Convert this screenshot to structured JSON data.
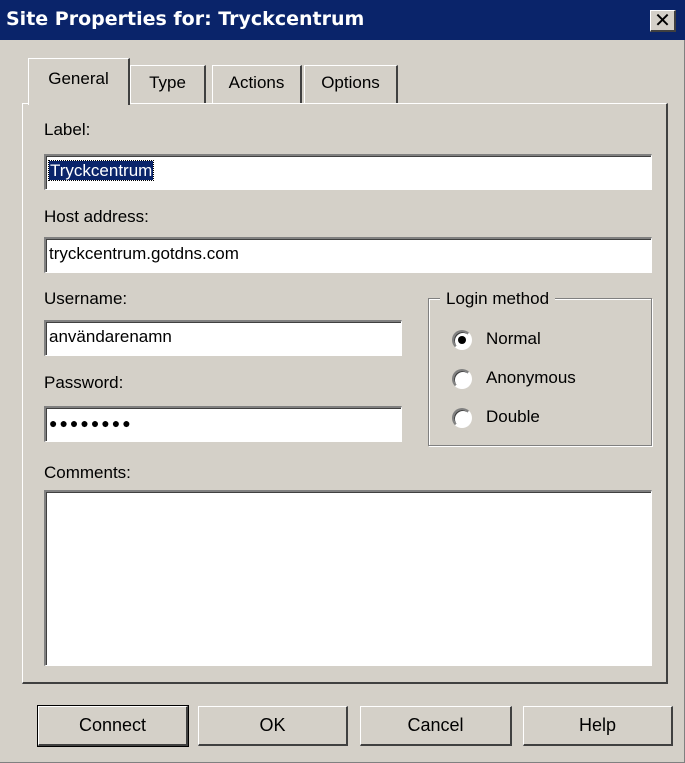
{
  "window": {
    "title": "Site Properties for: Tryckcentrum",
    "close_glyph": "✕"
  },
  "tabs": [
    {
      "label": "General",
      "active": true
    },
    {
      "label": "Type",
      "active": false
    },
    {
      "label": "Actions",
      "active": false
    },
    {
      "label": "Options",
      "active": false
    }
  ],
  "form": {
    "label_caption": "Label:",
    "label_value": "Tryckcentrum",
    "host_caption": "Host address:",
    "host_value": "tryckcentrum.gotdns.com",
    "username_caption": "Username:",
    "username_value": "användarenamn",
    "password_caption": "Password:",
    "password_value": "●●●●●●●●",
    "comments_caption": "Comments:",
    "comments_value": ""
  },
  "login_method": {
    "caption": "Login method",
    "options": [
      {
        "label": "Normal",
        "selected": true
      },
      {
        "label": "Anonymous",
        "selected": false
      },
      {
        "label": "Double",
        "selected": false
      }
    ]
  },
  "buttons": {
    "connect": "Connect",
    "ok": "OK",
    "cancel": "Cancel",
    "help": "Help"
  },
  "icons": {
    "close": "close-icon",
    "radio": "radio-dot-icon"
  }
}
